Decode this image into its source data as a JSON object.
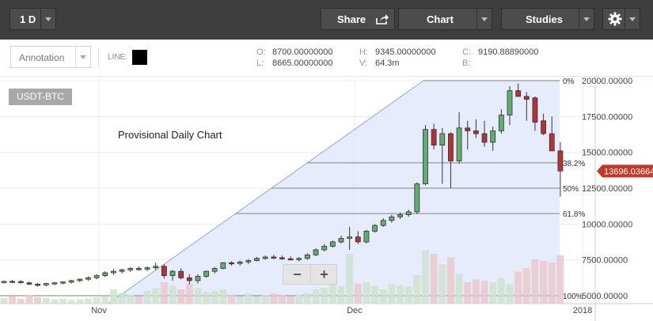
{
  "toolbar": {
    "interval": "1 D",
    "share": "Share",
    "chart": "Chart",
    "studies": "Studies",
    "settings_icon": "gear-icon",
    "share_icon": "share-arrow-icon"
  },
  "annotation": {
    "label": "Annotation",
    "line_label": "LINE:",
    "line_color": "#000000"
  },
  "ohlc": {
    "o_label": "O:",
    "o": "8700.00000000",
    "l_label": "L:",
    "l": "8665.00000000",
    "h_label": "H:",
    "h": "9345.00000000",
    "v_label": "V:",
    "v": "64.3m",
    "c_label": "C:",
    "c": "9190.88890000",
    "b_label": "B:",
    "b": ""
  },
  "pair": "USDT-BTC",
  "chart_data": {
    "type": "candlestick",
    "title": "Provisional Daily Chart",
    "y_ticks": [
      "20000.00000",
      "17500.00000",
      "15000.00000",
      "12500.00000",
      "10000.00000",
      "7500.00000",
      "5000.00000"
    ],
    "y_tick_values": [
      20000,
      17500,
      15000,
      12500,
      10000,
      7500,
      5000
    ],
    "ylim": [
      4800,
      20400
    ],
    "x_ticks": [
      "Nov",
      "Dec",
      "2018"
    ],
    "current_price": "13696.03664",
    "current_price_color": "#c0392b",
    "up_color": "#5fae6e",
    "down_color": "#b53232",
    "fib_levels": [
      {
        "label": "0%",
        "value": 20000
      },
      {
        "label": "38.2%",
        "value": 14270
      },
      {
        "label": "50%",
        "value": 12500
      },
      {
        "label": "61.8%",
        "value": 10730
      },
      {
        "label": "100%",
        "value": 5000
      }
    ],
    "candles": [
      [
        5950,
        6050,
        5850,
        6000
      ],
      [
        6000,
        6100,
        5900,
        5980
      ],
      [
        5990,
        6080,
        5850,
        5920
      ],
      [
        5900,
        5980,
        5750,
        5800
      ],
      [
        5800,
        5900,
        5650,
        5740
      ],
      [
        5750,
        5900,
        5650,
        5850
      ],
      [
        5850,
        5950,
        5750,
        5900
      ],
      [
        5900,
        6000,
        5800,
        5960
      ],
      [
        5950,
        6100,
        5850,
        6050
      ],
      [
        6050,
        6200,
        5950,
        6150
      ],
      [
        6150,
        6350,
        6050,
        6250
      ],
      [
        6250,
        6500,
        6150,
        6400
      ],
      [
        6400,
        6700,
        6300,
        6600
      ],
      [
        6600,
        6850,
        6450,
        6700
      ],
      [
        6700,
        6900,
        6550,
        6800
      ],
      [
        6800,
        7000,
        6650,
        6900
      ],
      [
        6900,
        7050,
        6750,
        6850
      ],
      [
        6850,
        7050,
        6700,
        6950
      ],
      [
        6950,
        7300,
        6800,
        7050
      ],
      [
        7050,
        7200,
        6200,
        6400
      ],
      [
        6400,
        6800,
        6050,
        6700
      ],
      [
        6700,
        6900,
        6150,
        6250
      ],
      [
        6250,
        6500,
        5800,
        6050
      ],
      [
        6050,
        6500,
        5850,
        6350
      ],
      [
        6350,
        6750,
        6250,
        6700
      ],
      [
        6700,
        7000,
        6550,
        6900
      ],
      [
        6900,
        7350,
        6850,
        7300
      ],
      [
        7300,
        7400,
        7100,
        7250
      ],
      [
        7250,
        7450,
        7100,
        7350
      ],
      [
        7350,
        7550,
        7200,
        7450
      ],
      [
        7450,
        7700,
        7400,
        7600
      ],
      [
        7600,
        7800,
        7500,
        7700
      ],
      [
        7700,
        7850,
        7550,
        7650
      ],
      [
        7650,
        7800,
        7500,
        7580
      ],
      [
        7580,
        7750,
        7450,
        7550
      ],
      [
        7550,
        7700,
        7400,
        7600
      ],
      [
        7600,
        7950,
        7500,
        7850
      ],
      [
        7850,
        8300,
        7750,
        8200
      ],
      [
        8200,
        8600,
        8100,
        8450
      ],
      [
        8450,
        8850,
        8350,
        8750
      ],
      [
        8750,
        9200,
        8650,
        9000
      ],
      [
        9000,
        9800,
        8200,
        9100
      ],
      [
        9100,
        9500,
        8600,
        8750
      ],
      [
        8750,
        9600,
        8650,
        9500
      ],
      [
        9500,
        10000,
        9400,
        9900
      ],
      [
        9900,
        10400,
        9800,
        10250
      ],
      [
        10250,
        10650,
        10100,
        10500
      ],
      [
        10500,
        10800,
        10350,
        10650
      ],
      [
        10650,
        11000,
        10500,
        10850
      ],
      [
        10850,
        12900,
        10700,
        12800
      ],
      [
        12800,
        16900,
        12700,
        16600
      ],
      [
        16600,
        17000,
        15200,
        15500
      ],
      [
        15500,
        16700,
        12800,
        16300
      ],
      [
        16300,
        16400,
        12500,
        14400
      ],
      [
        14400,
        17800,
        14200,
        16700
      ],
      [
        16700,
        17200,
        15200,
        16500
      ],
      [
        16500,
        17300,
        16000,
        16300
      ],
      [
        16300,
        17200,
        15400,
        15700
      ],
      [
        15700,
        16800,
        15100,
        16500
      ],
      [
        16500,
        18000,
        16300,
        17600
      ],
      [
        17600,
        19600,
        16900,
        19300
      ],
      [
        19300,
        19800,
        18900,
        18900
      ],
      [
        18900,
        19200,
        17200,
        18700
      ],
      [
        18800,
        18900,
        16500,
        17100
      ],
      [
        17200,
        17700,
        16200,
        16300
      ],
      [
        16300,
        17500,
        15600,
        15100
      ],
      [
        15100,
        15700,
        11900,
        13700
      ]
    ],
    "volumes": [
      0.08,
      0.1,
      0.07,
      0.12,
      0.09,
      0.08,
      0.06,
      0.07,
      0.05,
      0.06,
      0.07,
      0.09,
      0.1,
      0.2,
      0.15,
      0.12,
      0.1,
      0.18,
      0.22,
      0.3,
      0.25,
      0.2,
      0.28,
      0.22,
      0.16,
      0.18,
      0.2,
      0.12,
      0.1,
      0.14,
      0.1,
      0.12,
      0.14,
      0.12,
      0.1,
      0.13,
      0.15,
      0.2,
      0.22,
      0.3,
      0.25,
      0.7,
      0.28,
      0.3,
      0.25,
      0.2,
      0.28,
      0.26,
      0.24,
      0.4,
      0.75,
      0.7,
      0.55,
      0.65,
      0.42,
      0.3,
      0.34,
      0.32,
      0.3,
      0.36,
      0.28,
      0.45,
      0.5,
      0.62,
      0.6,
      0.58,
      0.68
    ]
  }
}
